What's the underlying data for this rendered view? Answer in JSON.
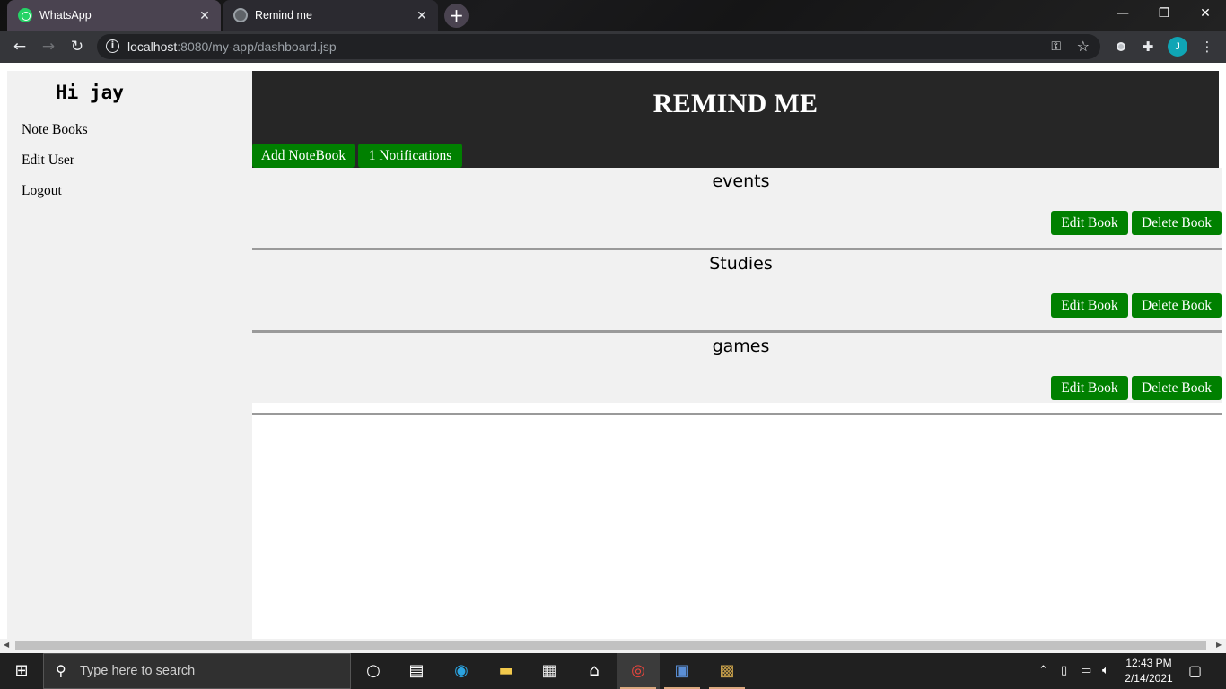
{
  "browser": {
    "tabs": [
      {
        "title": "WhatsApp",
        "icon": "whatsapp-icon"
      },
      {
        "title": "Remind me",
        "icon": "globe-icon"
      }
    ],
    "url_host": "localhost",
    "url_rest": ":8080/my-app/dashboard.jsp",
    "profile_initial": "J"
  },
  "sidebar": {
    "greeting": "Hi jay",
    "links": [
      "Note Books",
      "Edit User",
      "Logout"
    ]
  },
  "header": {
    "title": "REMIND ME",
    "add_button": "Add NoteBook",
    "notifications_button": "1 Notifications"
  },
  "books": [
    {
      "title": "events",
      "edit": "Edit Book",
      "delete": "Delete Book"
    },
    {
      "title": "Studies",
      "edit": "Edit Book",
      "delete": "Delete Book"
    },
    {
      "title": "games",
      "edit": "Edit Book",
      "delete": "Delete Book"
    }
  ],
  "taskbar": {
    "search_placeholder": "Type here to search",
    "time": "12:43 PM",
    "date": "2/14/2021"
  },
  "colors": {
    "accent_green": "#008000",
    "header_bg": "#262626",
    "panel_bg": "#f1f1f1"
  }
}
